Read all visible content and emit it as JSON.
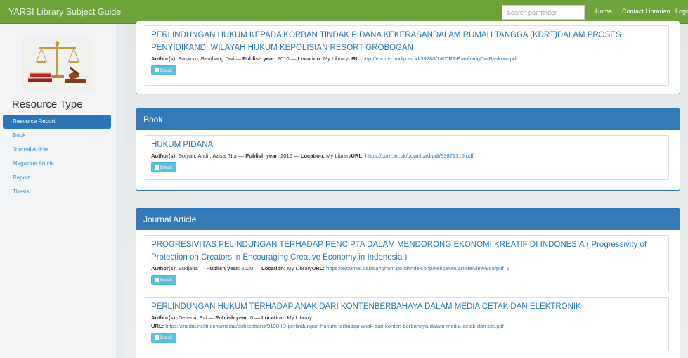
{
  "header": {
    "brand": "YARSI Library Subject Guide",
    "search_placeholder": "Search pathfinder",
    "nav": [
      "Home",
      "Contact Librarian",
      "Login"
    ]
  },
  "sidebar": {
    "title": "Resource Type",
    "items": [
      "Resource Report",
      "Book",
      "Journal Article",
      "Magazine Article",
      "Report",
      "Thesis"
    ],
    "active_index": 0
  },
  "labels": {
    "author": "Author(s):",
    "year": "Publish year:",
    "location": "Location:",
    "url": "URL:",
    "detail": "Detail",
    "sep": " — "
  },
  "top_card": {
    "title": "PERLINDUNGAN HUKUM KEPADA KORBAN TINDAK PIDANA KEKERASANDALAM RUMAH TANGGA (KDRT)DALAM PROSES PENYIDIKANDI WILAYAH HUKUM KEPOLISIAN RESORT GROBOGAN",
    "author": "Baskoro, Bambang Dwi",
    "year": "2010",
    "location": "My Library",
    "url": "http://eprints.undip.ac.id/39280/1/KDRT-BambangDwiBaskoro.pdf"
  },
  "book": {
    "heading": "Book",
    "card": {
      "title": "HUKUM PIDANA",
      "author": "Sofyan, Andi ; Azisa, Nur",
      "year": "2016",
      "location": "My Library",
      "url": "https://core.ac.uk/download/pdf/83871315.pdf"
    }
  },
  "journal": {
    "heading": "Journal Article",
    "cards": [
      {
        "title": "PROGRESIVITAS PELINDUNGAN TERHADAP PENCIPTA DALAM MENDORONG EKONOMI KREATIF DI INDONESIA ( Progressivity of Protection on Creators in Encouraging Creative Economy in Indonesia )",
        "author": "Sudjana",
        "year": "2020",
        "location": "My Library",
        "url": "https://ejournal.balitbangham.go.id/index.php/kebijakan/article/view/969/pdf_1"
      },
      {
        "title": "PERLINDUNGAN HUKUM TERHADAP ANAK DARI KONTENBERBAHAYA DALAM MEDIA CETAK DAN ELEKTRONIK",
        "author": "Deliana, Evi",
        "year": "0",
        "location": "My Library",
        "url": "https://media.neliti.com/media/publications/9138-ID-perlindungan-hukum-terhadap-anak-dari-konten-berbahaya-dalam-media-cetak-dan-ele.pdf"
      }
    ]
  },
  "colors": {
    "topbar": "#6fa33a",
    "primary": "#337ab7",
    "detail": "#5bc0de"
  }
}
